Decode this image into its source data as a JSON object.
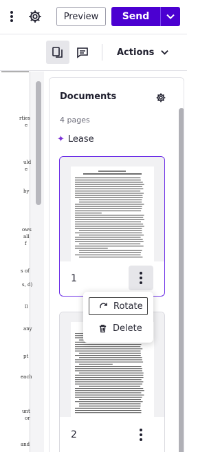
{
  "topbar": {
    "more_icon": "vertical-ellipsis",
    "settings_icon": "gear",
    "preview_label": "Preview",
    "send_label": "Send",
    "send_menu_icon": "chevron-down"
  },
  "toolbar": {
    "view_pages_icon": "pages",
    "comments_icon": "comment",
    "actions_label": "Actions",
    "actions_icon": "chevron-down"
  },
  "document_fragments": [
    "rties",
    "e",
    "uld",
    "e",
    "by",
    "ows",
    "all",
    "f",
    "s of",
    "s, d)",
    "ll",
    "any",
    "pt",
    "each",
    "unt",
    "or",
    "and"
  ],
  "panel": {
    "title": "Documents",
    "settings_icon": "gear",
    "page_count": "4 pages",
    "document_name": "Lease",
    "document_icon": "sparkle"
  },
  "pages": [
    {
      "number": "1",
      "selected": true
    },
    {
      "number": "2",
      "selected": false
    }
  ],
  "context_menu": {
    "rotate_label": "Rotate",
    "rotate_icon": "rotate-clockwise",
    "delete_label": "Delete",
    "delete_icon": "trash"
  },
  "colors": {
    "accent": "#4b00d1",
    "selected_border": "#6a2ce6",
    "sparkle": "#7a2fd6"
  }
}
